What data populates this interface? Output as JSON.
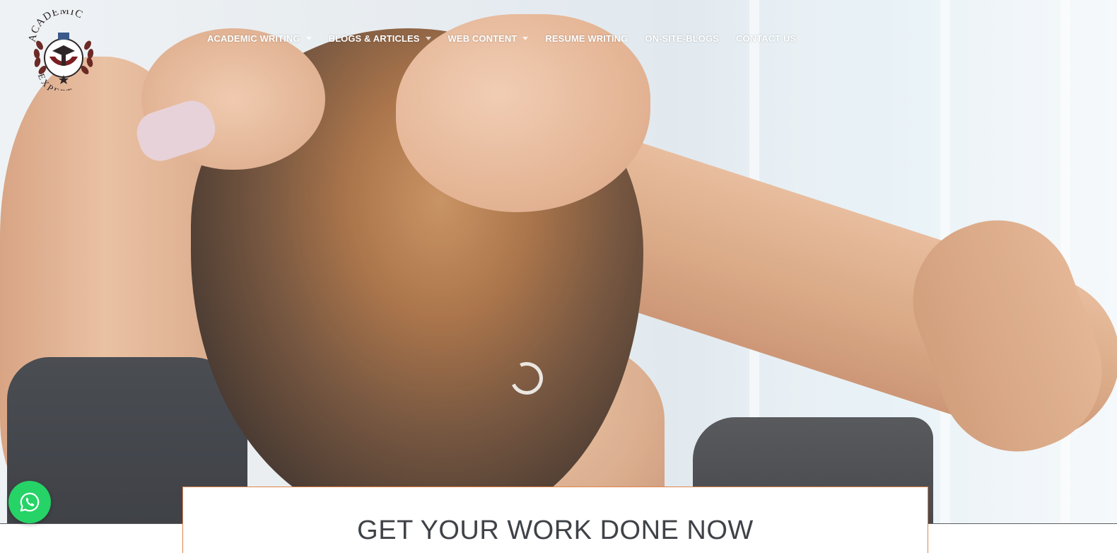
{
  "brand": {
    "logo_text_top": "ACADEMIC",
    "logo_text_bottom": "EXPERT",
    "logo_icon": "graduation-cap-laurel-icon"
  },
  "nav": {
    "items": [
      {
        "label": "ACADEMIC WRITING",
        "has_dropdown": true
      },
      {
        "label": "BLOGS & ARTICLES",
        "has_dropdown": true
      },
      {
        "label": "WEB CONTENT",
        "has_dropdown": true
      },
      {
        "label": "RESUME WRITING",
        "has_dropdown": false
      },
      {
        "label": "ON-SITE-BLOGS",
        "has_dropdown": false
      },
      {
        "label": "CONTACT US",
        "has_dropdown": false
      }
    ]
  },
  "hero": {
    "image_icon": "woman-tying-hair-photo"
  },
  "cta": {
    "title": "GET YOUR WORK DONE NOW"
  },
  "whatsapp": {
    "icon": "whatsapp-icon",
    "color": "#25d366"
  },
  "colors": {
    "accent_border": "#e0844a",
    "logo_dark": "#3a2a2a",
    "logo_red": "#7a1f22",
    "text_dark": "#3f4247"
  }
}
